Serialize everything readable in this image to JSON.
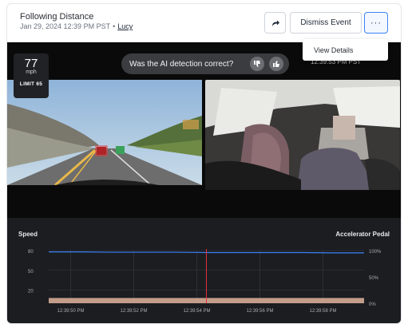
{
  "header": {
    "title": "Following Distance",
    "date": "Jan 29, 2024 12:39 PM PST",
    "separator": "•",
    "driver": "Lucy",
    "dismiss_label": "Dismiss Event",
    "more_label": "···"
  },
  "menu": {
    "items": [
      "View Details"
    ]
  },
  "video": {
    "speed": "77",
    "speed_unit": "mph",
    "speed_limit": "LIMIT 65",
    "ai_prompt": "Was the AI detection correct?",
    "timestamp": "12:39:53 PM PST"
  },
  "chart_data": {
    "type": "line",
    "title": "",
    "left_label": "Speed",
    "right_label": "Accelerator Pedal",
    "y_left_ticks": [
      "80",
      "50",
      "20"
    ],
    "y_right_ticks": [
      "100%",
      "50%",
      "0%"
    ],
    "x_ticks": [
      "12:39:50 PM",
      "12:39:52 PM",
      "12:39:54 PM",
      "12:39:56 PM",
      "12:39:58 PM"
    ],
    "ylim": [
      0,
      80
    ],
    "series": [
      {
        "name": "Speed",
        "color": "#3b82f6",
        "x": [
          0,
          1,
          2,
          3,
          4,
          5,
          6,
          7,
          8,
          9,
          10
        ],
        "values": [
          78,
          78,
          77.5,
          77.5,
          77.5,
          77,
          77,
          77,
          77,
          76.5,
          76.5
        ]
      },
      {
        "name": "Accelerator Pedal",
        "color": "#e0b49b",
        "x": [
          0,
          1,
          2,
          3,
          4,
          5,
          6,
          7,
          8,
          9,
          10
        ],
        "values": [
          8,
          8,
          8,
          8,
          8,
          8,
          8,
          8,
          8,
          8,
          8
        ]
      }
    ],
    "marker_x": 5,
    "marker_color": "#e1323c"
  }
}
